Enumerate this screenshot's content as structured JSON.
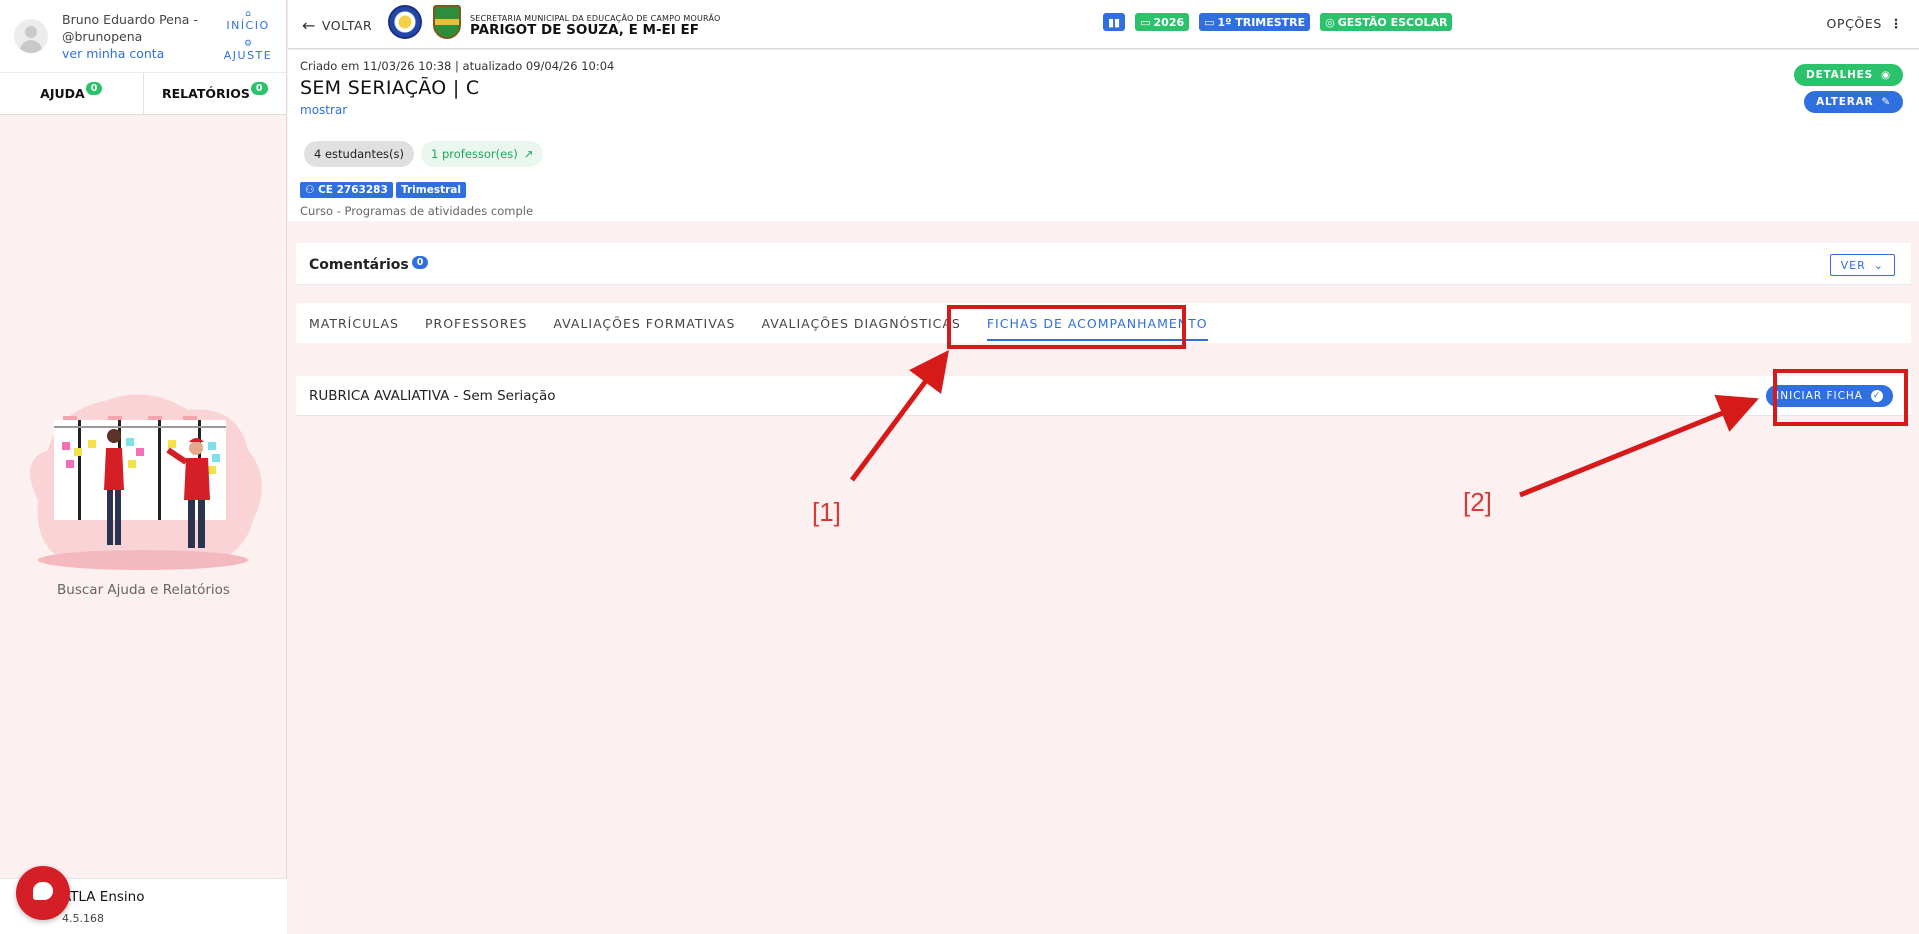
{
  "sidebar": {
    "user_name": "Bruno Eduardo Pena - @brunopena",
    "account_link": "ver minha conta",
    "quick_home": "INÍCIO",
    "quick_settings": "AJUSTE",
    "tab_help": "AJUDA",
    "tab_help_count": "0",
    "tab_reports": "RELATÓRIOS",
    "tab_reports_count": "0",
    "help_text": "Buscar Ajuda e Relatórios",
    "footer_name": "ATLA Ensino",
    "footer_version": "4.5.168"
  },
  "topbar": {
    "back_label": "VOLTAR",
    "org_sub": "SECRETARIA MUNICIPAL DA EDUCAÇÃO DE CAMPO MOURÃO",
    "org_main": "PARIGOT DE SOUZA, E M-EI EF",
    "badge_year": "2026",
    "badge_term": "1º TRIMESTRE",
    "badge_mgmt": "GESTÃO ESCOLAR",
    "options_label": "OPÇÕES"
  },
  "info": {
    "created": "Criado em 11/03/26 10:38 | atualizado 09/04/26 10:04",
    "title": "SEM SERIAÇÃO | C",
    "show_link": "mostrar",
    "students": "4 estudantes(s)",
    "teachers": "1 professor(es)",
    "tag_code": "CE 2763283",
    "tag_period": "Trimestral",
    "course": "Curso - Programas de atividades comple",
    "btn_details": "DETALHES",
    "btn_edit": "ALTERAR"
  },
  "comments": {
    "label": "Comentários",
    "count": "0",
    "ver_label": "VER"
  },
  "tabs": [
    {
      "label": "MATRÍCULAS"
    },
    {
      "label": "PROFESSORES"
    },
    {
      "label": "AVALIAÇÕES FORMATIVAS"
    },
    {
      "label": "AVALIAÇÕES DIAGNÓSTICAS"
    },
    {
      "label": "FICHAS DE ACOMPANHAMENTO"
    }
  ],
  "rubrica": {
    "label": "RUBRICA AVALIATIVA - Sem Seriação",
    "start_label": "INICIAR FICHA"
  },
  "annotations": {
    "mark1": "[1]",
    "mark2": "[2]",
    "color": "#d61a1a"
  },
  "colors": {
    "primary": "#2f6fe0",
    "success": "#2bc26b",
    "background": "#fdf0f0"
  }
}
